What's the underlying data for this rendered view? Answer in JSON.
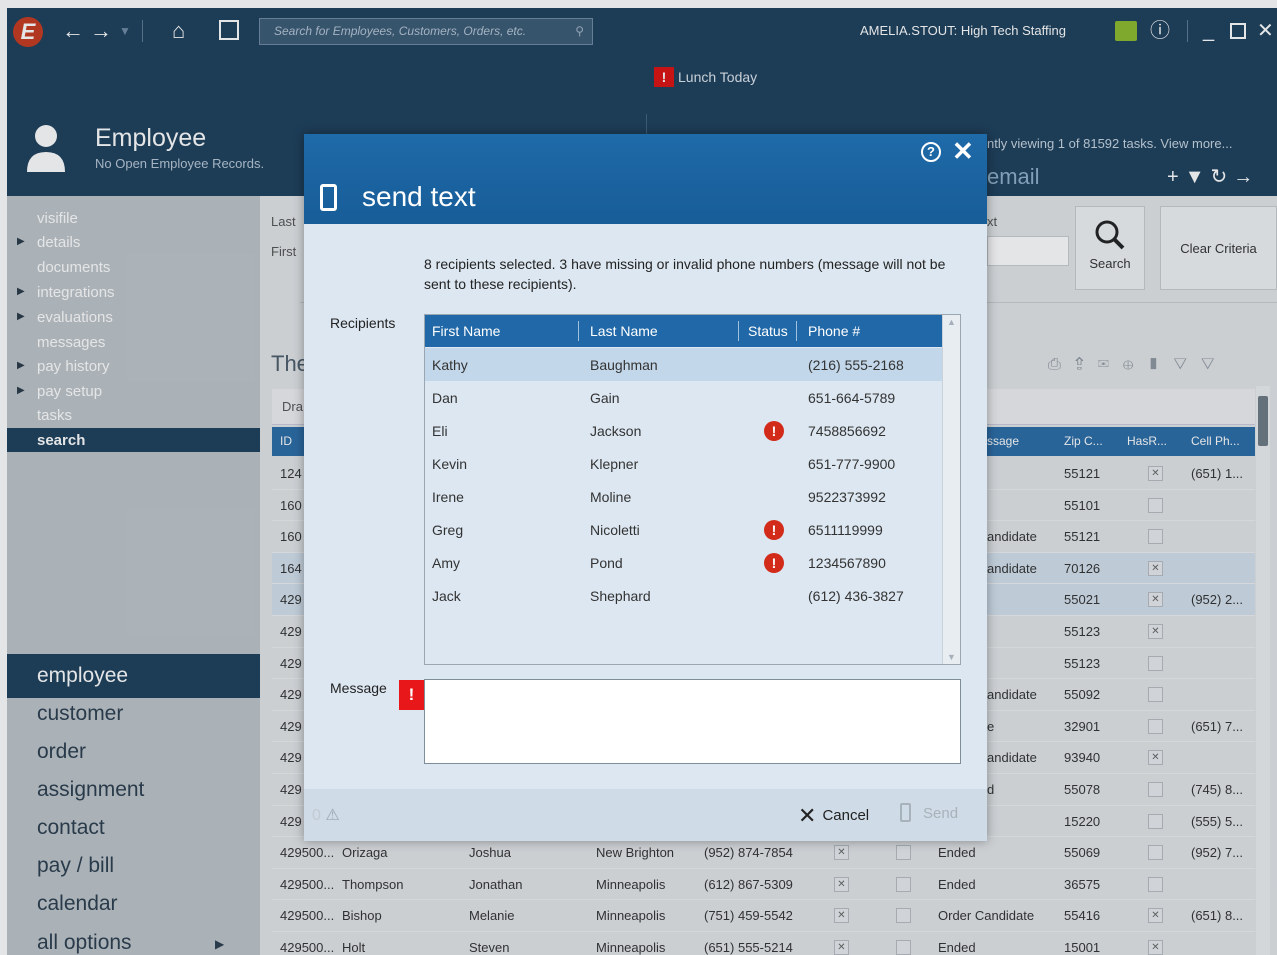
{
  "topbar": {
    "logo": "E",
    "search_placeholder": "Search for Employees, Customers, Orders, etc.",
    "user": "AMELIA.STOUT: High Tech Staffing"
  },
  "header": {
    "title": "Employee",
    "subtitle": "No Open Employee Records.",
    "lunch": "Lunch Today",
    "task_info": "ntly viewing 1 of 81592 tasks. View more...",
    "email_label": "email"
  },
  "sidebar": {
    "items": [
      {
        "label": "visifile",
        "arrow": false
      },
      {
        "label": "details",
        "arrow": true
      },
      {
        "label": "documents",
        "arrow": false
      },
      {
        "label": "integrations",
        "arrow": true
      },
      {
        "label": "evaluations",
        "arrow": true
      },
      {
        "label": "messages",
        "arrow": false
      },
      {
        "label": "pay history",
        "arrow": true
      },
      {
        "label": "pay setup",
        "arrow": true
      },
      {
        "label": "tasks",
        "arrow": false
      },
      {
        "label": "search",
        "arrow": false
      }
    ],
    "modules": [
      "employee",
      "customer",
      "order",
      "assignment",
      "contact",
      "pay / bill",
      "calendar",
      "all options"
    ]
  },
  "main": {
    "crit_last": "Last",
    "crit_first": "First",
    "crit_ext": "xt",
    "search_btn": "Search",
    "clear_btn": "Clear Criteria",
    "results_title": "The",
    "drag_hint": "Dra",
    "grid_cols": [
      "ID",
      "ssage",
      "Zip C...",
      "HasR...",
      "Cell Ph..."
    ],
    "rows": [
      {
        "id": "124",
        "msg": "",
        "zip": "55121",
        "hasr": true,
        "cell": "(651) 1..."
      },
      {
        "id": "160",
        "msg": "",
        "zip": "55101",
        "hasr": false,
        "cell": ""
      },
      {
        "id": "160",
        "msg": "andidate",
        "zip": "55121",
        "hasr": false,
        "cell": ""
      },
      {
        "id": "164",
        "msg": "andidate",
        "zip": "70126",
        "hasr": true,
        "cell": ""
      },
      {
        "id": "429",
        "msg": "",
        "zip": "55021",
        "hasr": true,
        "cell": "(952) 2..."
      },
      {
        "id": "429",
        "msg": "",
        "zip": "55123",
        "hasr": true,
        "cell": ""
      },
      {
        "id": "429",
        "msg": "",
        "zip": "55123",
        "hasr": false,
        "cell": ""
      },
      {
        "id": "429",
        "msg": "andidate",
        "zip": "55092",
        "hasr": false,
        "cell": ""
      },
      {
        "id": "429",
        "msg": "e",
        "zip": "32901",
        "hasr": false,
        "cell": "(651) 7..."
      },
      {
        "id": "429",
        "msg": "andidate",
        "zip": "93940",
        "hasr": true,
        "cell": ""
      },
      {
        "id": "429",
        "msg": "d",
        "zip": "55078",
        "hasr": false,
        "cell": "(745) 8..."
      },
      {
        "id": "429",
        "msg": "",
        "zip": "15220",
        "hasr": false,
        "cell": "(555) 5..."
      }
    ],
    "full_rows": [
      {
        "id": "429500...",
        "last": "Orizaga",
        "first": "Joshua",
        "city": "New Brighton",
        "phone": "(952) 874-7854",
        "status": "Ended",
        "zip": "55069",
        "hasr": false,
        "cell": "(952) 7..."
      },
      {
        "id": "429500...",
        "last": "Thompson",
        "first": "Jonathan",
        "city": "Minneapolis",
        "phone": "(612) 867-5309",
        "status": "Ended",
        "zip": "36575",
        "hasr": false,
        "cell": ""
      },
      {
        "id": "429500...",
        "last": "Bishop",
        "first": "Melanie",
        "city": "Minneapolis",
        "phone": "(751) 459-5542",
        "status": "Order Candidate",
        "zip": "55416",
        "hasr": true,
        "cell": "(651) 8..."
      },
      {
        "id": "429500...",
        "last": "Holt",
        "first": "Steven",
        "city": "Minneapolis",
        "phone": "(651) 555-5214",
        "status": "Ended",
        "zip": "15001",
        "hasr": true,
        "cell": ""
      }
    ]
  },
  "dialog": {
    "title": "send text",
    "note": "8 recipients selected. 3 have missing or invalid phone numbers (message will not be sent to these recipients).",
    "recipients_label": "Recipients",
    "columns": [
      "First Name",
      "Last Name",
      "Status",
      "Phone #"
    ],
    "recipients": [
      {
        "first": "Kathy",
        "last": "Baughman",
        "invalid": false,
        "phone": "(216) 555-2168"
      },
      {
        "first": "Dan",
        "last": "Gain",
        "invalid": false,
        "phone": "651-664-5789"
      },
      {
        "first": "Eli",
        "last": "Jackson",
        "invalid": true,
        "phone": "7458856692"
      },
      {
        "first": "Kevin",
        "last": "Klepner",
        "invalid": false,
        "phone": "651-777-9900"
      },
      {
        "first": "Irene",
        "last": "Moline",
        "invalid": false,
        "phone": "9522373992"
      },
      {
        "first": "Greg",
        "last": "Nicoletti",
        "invalid": true,
        "phone": "6511119999"
      },
      {
        "first": "Amy",
        "last": "Pond",
        "invalid": true,
        "phone": "1234567890"
      },
      {
        "first": "Jack",
        "last": "Shephard",
        "invalid": false,
        "phone": "(612) 436-3827"
      }
    ],
    "message_label": "Message",
    "message_value": "",
    "error_count": "0",
    "cancel": "Cancel",
    "send": "Send"
  }
}
